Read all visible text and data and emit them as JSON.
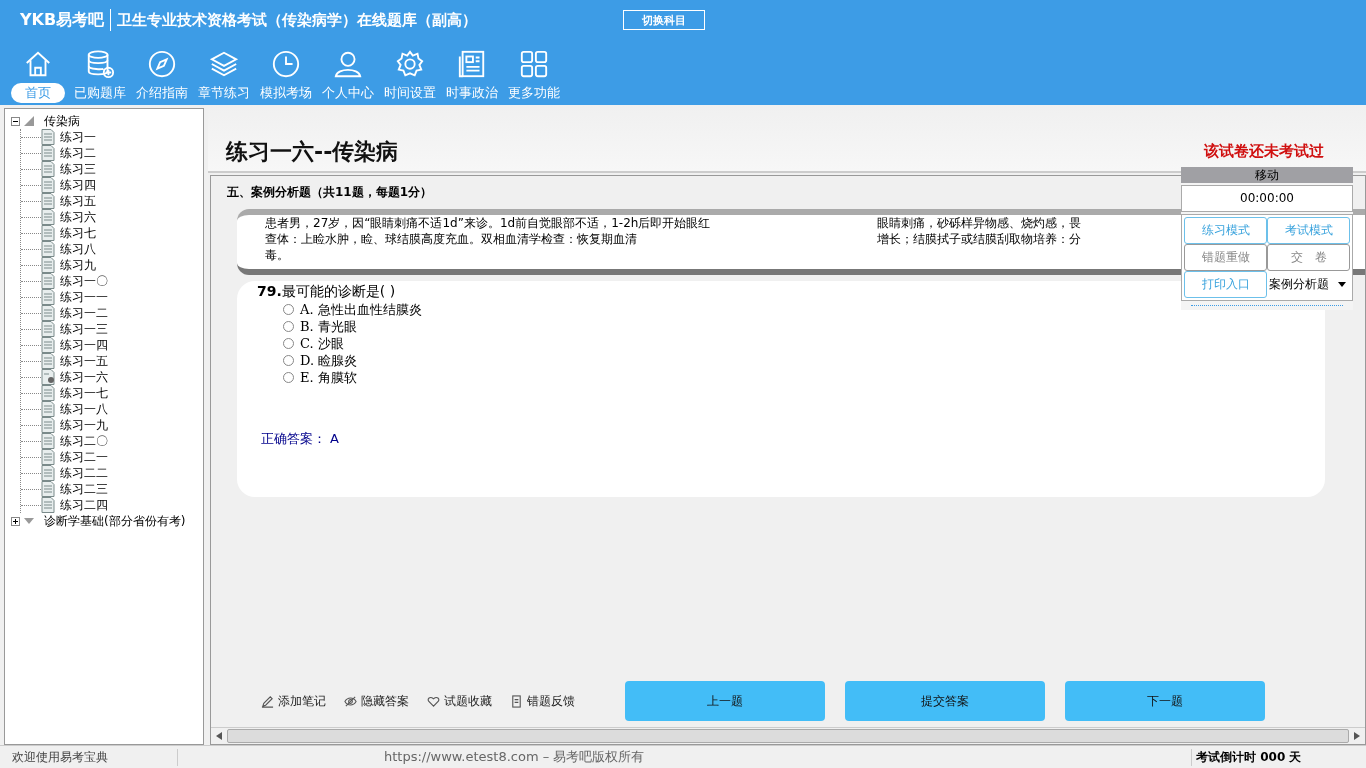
{
  "header": {
    "logo": "YKB易考吧",
    "title": "卫生专业技术资格考试（传染病学）在线题库（副高）",
    "switch_button": "切换科目"
  },
  "nav": [
    {
      "label": "首页",
      "selected": true
    },
    {
      "label": "已购题库",
      "selected": false
    },
    {
      "label": "介绍指南",
      "selected": false
    },
    {
      "label": "章节练习",
      "selected": false
    },
    {
      "label": "模拟考场",
      "selected": false
    },
    {
      "label": "个人中心",
      "selected": false
    },
    {
      "label": "时间设置",
      "selected": false
    },
    {
      "label": "时事政治",
      "selected": false
    },
    {
      "label": "更多功能",
      "selected": false
    }
  ],
  "tree": [
    {
      "label": "传染病",
      "expanded": true,
      "children": [
        {
          "label": "练习一",
          "selected": false
        },
        {
          "label": "练习二",
          "selected": false
        },
        {
          "label": "练习三",
          "selected": false
        },
        {
          "label": "练习四",
          "selected": false
        },
        {
          "label": "练习五",
          "selected": false
        },
        {
          "label": "练习六",
          "selected": false
        },
        {
          "label": "练习七",
          "selected": false
        },
        {
          "label": "练习八",
          "selected": false
        },
        {
          "label": "练习九",
          "selected": false
        },
        {
          "label": "练习一〇",
          "selected": false
        },
        {
          "label": "练习一一",
          "selected": false
        },
        {
          "label": "练习一二",
          "selected": false
        },
        {
          "label": "练习一三",
          "selected": false
        },
        {
          "label": "练习一四",
          "selected": false
        },
        {
          "label": "练习一五",
          "selected": false
        },
        {
          "label": "练习一六",
          "selected": true
        },
        {
          "label": "练习一七",
          "selected": false
        },
        {
          "label": "练习一八",
          "selected": false
        },
        {
          "label": "练习一九",
          "selected": false
        },
        {
          "label": "练习二〇",
          "selected": false
        },
        {
          "label": "练习二一",
          "selected": false
        },
        {
          "label": "练习二二",
          "selected": false
        },
        {
          "label": "练习二三",
          "selected": false
        },
        {
          "label": "练习二四",
          "selected": false
        }
      ]
    },
    {
      "label": "诊断学基础(部分省份有考)",
      "expanded": false
    }
  ],
  "paper": {
    "title": "练习一六--传染病",
    "status": "该试卷还未考试过"
  },
  "section": "五、案例分析题（共11题，每题1分）",
  "passage": [
    [
      "患者男，27岁，因“眼睛刺痛不适1d”来诊。1d前自觉眼部不适，1-2h后即开始眼红",
      "眼睛刺痛，砂砾样异物感、烧灼感，畏"
    ],
    [
      "查体：上睑水肿，睑、球结膜高度充血。双相血清学检查：恢复期血清",
      "增长；结膜拭子或结膜刮取物培养：分"
    ],
    [
      "毒。"
    ]
  ],
  "question": {
    "number": "79.",
    "text": "最可能的诊断是( )",
    "options": [
      {
        "label": "A. 急性出血性结膜炎",
        "selected": false
      },
      {
        "label": "B. 青光眼",
        "selected": false
      },
      {
        "label": "C. 沙眼",
        "selected": false
      },
      {
        "label": "D. 睑腺炎",
        "selected": false
      },
      {
        "label": "E. 角膜软",
        "selected": false
      }
    ],
    "answer_label": "正确答案：",
    "answer": "A"
  },
  "side_panel": {
    "title": "移动",
    "timer": "00:00:00",
    "buttons": [
      {
        "label": "练习模式",
        "disabled": false
      },
      {
        "label": "考试模式",
        "disabled": false
      },
      {
        "label": "错题重做",
        "disabled": true
      },
      {
        "label": "交　卷",
        "disabled": true
      },
      {
        "label": "打印入口",
        "disabled": false
      }
    ],
    "type_select": "案例分析题"
  },
  "tools": [
    "添加笔记",
    "隐藏答案",
    "试题收藏",
    "错题反馈"
  ],
  "buttons": [
    "上一题",
    "提交答案",
    "下一题"
  ],
  "status_bar": {
    "welcome": "欢迎使用易考宝典",
    "copyright": "https://www.etest8.com – 易考吧版权所有",
    "countdown": "考试倒计时 000 天"
  }
}
